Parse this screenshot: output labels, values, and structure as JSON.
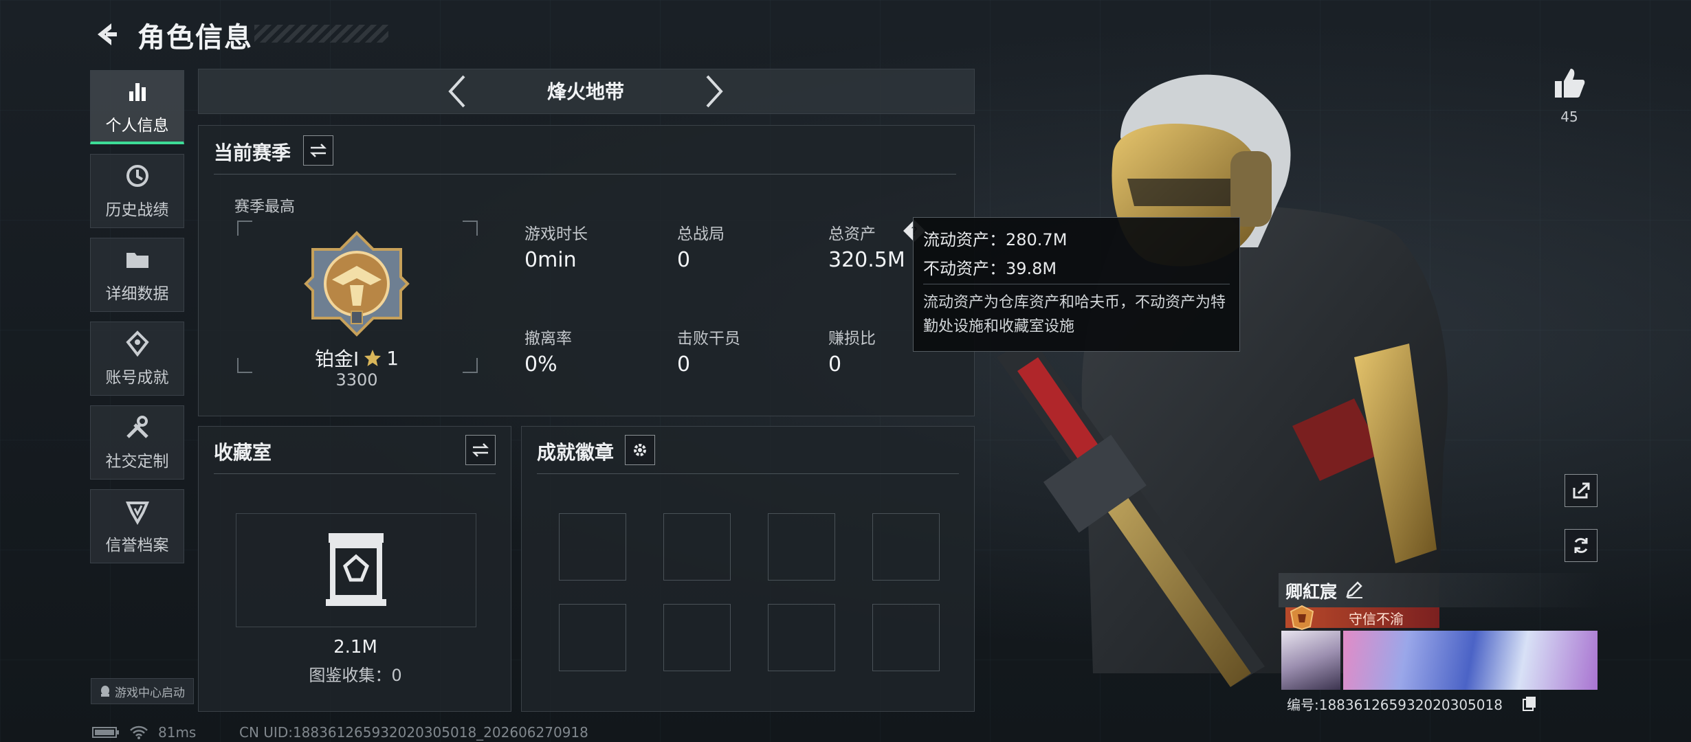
{
  "header": {
    "title": "角色信息"
  },
  "nav": {
    "items": [
      {
        "label": "个人信息",
        "icon": "bar-chart-icon",
        "active": true
      },
      {
        "label": "历史战绩",
        "icon": "history-icon"
      },
      {
        "label": "详细数据",
        "icon": "folder-icon"
      },
      {
        "label": "账号成就",
        "icon": "achievement-icon"
      },
      {
        "label": "社交定制",
        "icon": "tools-icon"
      },
      {
        "label": "信誉档案",
        "icon": "credit-icon"
      }
    ],
    "launch_label": "游戏中心启动"
  },
  "mode": {
    "label": "烽火地带"
  },
  "season": {
    "title": "当前赛季",
    "best_label": "赛季最高",
    "rank_name": "铂金I",
    "rank_stars": "1",
    "rank_score": "3300",
    "stats": [
      {
        "label": "游戏时长",
        "value": "0min"
      },
      {
        "label": "总战局",
        "value": "0"
      },
      {
        "label": "总资产",
        "value": "320.5M"
      },
      {
        "label": "撤离率",
        "value": "0%"
      },
      {
        "label": "击败干员",
        "value": "0"
      },
      {
        "label": "赚损比",
        "value": "0"
      }
    ]
  },
  "tooltip": {
    "liquid": "流动资产：280.7M",
    "fixed": "不动资产：39.8M",
    "desc": "流动资产为仓库资产和哈夫币，不动资产为特勤处设施和收藏室设施"
  },
  "collection": {
    "title": "收藏室",
    "value": "2.1M",
    "catalog": "图鉴收集：0"
  },
  "badges": {
    "title": "成就徽章",
    "slot_count": 8
  },
  "likes": {
    "count": "45"
  },
  "player": {
    "name": "卿紅宸",
    "title": "守信不渝",
    "id_label": "编号:1883612659320203050​18"
  },
  "status": {
    "ping": "81ms",
    "uid": "CN UID:1883612659320203050​18_202606270918"
  },
  "colors": {
    "accent": "#3ddc97",
    "title_badge": "#b94a2a"
  }
}
